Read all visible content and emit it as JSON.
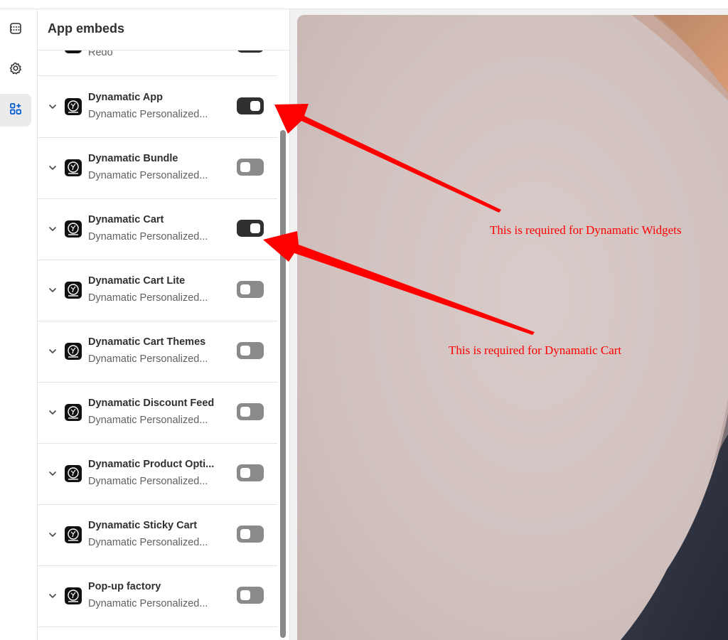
{
  "panel": {
    "title": "App embeds"
  },
  "rail": {
    "items": [
      {
        "icon": "sections-icon",
        "active": false
      },
      {
        "icon": "gear-icon",
        "active": false
      },
      {
        "icon": "apps-icon",
        "active": true
      }
    ]
  },
  "partial_item": {
    "subtitle": "Redo"
  },
  "embeds": [
    {
      "name": "Dynamatic App",
      "subtitle": "Dynamatic Personalized...",
      "enabled": true
    },
    {
      "name": "Dynamatic Bundle",
      "subtitle": "Dynamatic Personalized...",
      "enabled": false
    },
    {
      "name": "Dynamatic Cart",
      "subtitle": "Dynamatic Personalized...",
      "enabled": true
    },
    {
      "name": "Dynamatic Cart Lite",
      "subtitle": "Dynamatic Personalized...",
      "enabled": false
    },
    {
      "name": "Dynamatic Cart Themes",
      "subtitle": "Dynamatic Personalized...",
      "enabled": false
    },
    {
      "name": "Dynamatic Discount Feed",
      "subtitle": "Dynamatic Personalized...",
      "enabled": false
    },
    {
      "name": "Dynamatic Product Opti...",
      "subtitle": "Dynamatic Personalized...",
      "enabled": false
    },
    {
      "name": "Dynamatic Sticky Cart",
      "subtitle": "Dynamatic Personalized...",
      "enabled": false
    },
    {
      "name": "Pop-up factory",
      "subtitle": "Dynamatic Personalized...",
      "enabled": false
    }
  ],
  "annotations": {
    "widgets_note": "This is required for Dynamatic Widgets",
    "cart_note": "This is required for Dynamatic Cart",
    "color": "#ff0000"
  },
  "colors": {
    "toggle_on": "#303030",
    "toggle_off": "#8a8a8a",
    "active_rail": "#005bd3"
  }
}
